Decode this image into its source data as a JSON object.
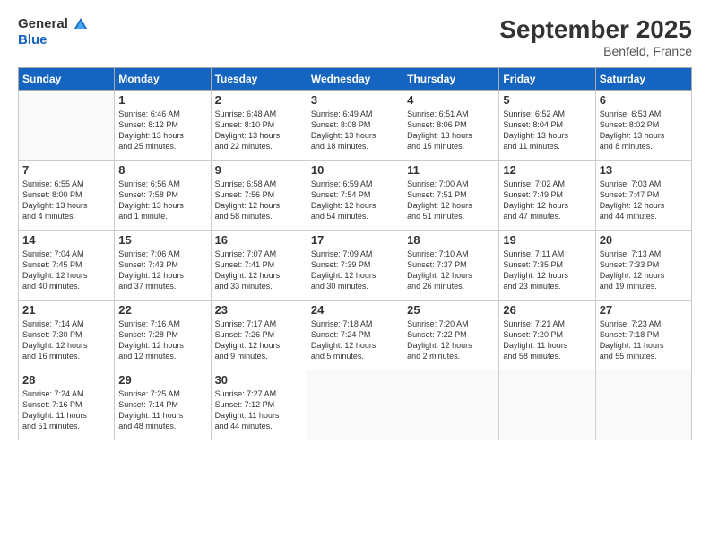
{
  "header": {
    "logo_general": "General",
    "logo_blue": "Blue",
    "month_title": "September 2025",
    "location": "Benfeld, France"
  },
  "columns": [
    "Sunday",
    "Monday",
    "Tuesday",
    "Wednesday",
    "Thursday",
    "Friday",
    "Saturday"
  ],
  "weeks": [
    {
      "days": [
        {
          "number": "",
          "lines": []
        },
        {
          "number": "1",
          "lines": [
            "Sunrise: 6:46 AM",
            "Sunset: 8:12 PM",
            "Daylight: 13 hours",
            "and 25 minutes."
          ]
        },
        {
          "number": "2",
          "lines": [
            "Sunrise: 6:48 AM",
            "Sunset: 8:10 PM",
            "Daylight: 13 hours",
            "and 22 minutes."
          ]
        },
        {
          "number": "3",
          "lines": [
            "Sunrise: 6:49 AM",
            "Sunset: 8:08 PM",
            "Daylight: 13 hours",
            "and 18 minutes."
          ]
        },
        {
          "number": "4",
          "lines": [
            "Sunrise: 6:51 AM",
            "Sunset: 8:06 PM",
            "Daylight: 13 hours",
            "and 15 minutes."
          ]
        },
        {
          "number": "5",
          "lines": [
            "Sunrise: 6:52 AM",
            "Sunset: 8:04 PM",
            "Daylight: 13 hours",
            "and 11 minutes."
          ]
        },
        {
          "number": "6",
          "lines": [
            "Sunrise: 6:53 AM",
            "Sunset: 8:02 PM",
            "Daylight: 13 hours",
            "and 8 minutes."
          ]
        }
      ]
    },
    {
      "days": [
        {
          "number": "7",
          "lines": [
            "Sunrise: 6:55 AM",
            "Sunset: 8:00 PM",
            "Daylight: 13 hours",
            "and 4 minutes."
          ]
        },
        {
          "number": "8",
          "lines": [
            "Sunrise: 6:56 AM",
            "Sunset: 7:58 PM",
            "Daylight: 13 hours",
            "and 1 minute."
          ]
        },
        {
          "number": "9",
          "lines": [
            "Sunrise: 6:58 AM",
            "Sunset: 7:56 PM",
            "Daylight: 12 hours",
            "and 58 minutes."
          ]
        },
        {
          "number": "10",
          "lines": [
            "Sunrise: 6:59 AM",
            "Sunset: 7:54 PM",
            "Daylight: 12 hours",
            "and 54 minutes."
          ]
        },
        {
          "number": "11",
          "lines": [
            "Sunrise: 7:00 AM",
            "Sunset: 7:51 PM",
            "Daylight: 12 hours",
            "and 51 minutes."
          ]
        },
        {
          "number": "12",
          "lines": [
            "Sunrise: 7:02 AM",
            "Sunset: 7:49 PM",
            "Daylight: 12 hours",
            "and 47 minutes."
          ]
        },
        {
          "number": "13",
          "lines": [
            "Sunrise: 7:03 AM",
            "Sunset: 7:47 PM",
            "Daylight: 12 hours",
            "and 44 minutes."
          ]
        }
      ]
    },
    {
      "days": [
        {
          "number": "14",
          "lines": [
            "Sunrise: 7:04 AM",
            "Sunset: 7:45 PM",
            "Daylight: 12 hours",
            "and 40 minutes."
          ]
        },
        {
          "number": "15",
          "lines": [
            "Sunrise: 7:06 AM",
            "Sunset: 7:43 PM",
            "Daylight: 12 hours",
            "and 37 minutes."
          ]
        },
        {
          "number": "16",
          "lines": [
            "Sunrise: 7:07 AM",
            "Sunset: 7:41 PM",
            "Daylight: 12 hours",
            "and 33 minutes."
          ]
        },
        {
          "number": "17",
          "lines": [
            "Sunrise: 7:09 AM",
            "Sunset: 7:39 PM",
            "Daylight: 12 hours",
            "and 30 minutes."
          ]
        },
        {
          "number": "18",
          "lines": [
            "Sunrise: 7:10 AM",
            "Sunset: 7:37 PM",
            "Daylight: 12 hours",
            "and 26 minutes."
          ]
        },
        {
          "number": "19",
          "lines": [
            "Sunrise: 7:11 AM",
            "Sunset: 7:35 PM",
            "Daylight: 12 hours",
            "and 23 minutes."
          ]
        },
        {
          "number": "20",
          "lines": [
            "Sunrise: 7:13 AM",
            "Sunset: 7:33 PM",
            "Daylight: 12 hours",
            "and 19 minutes."
          ]
        }
      ]
    },
    {
      "days": [
        {
          "number": "21",
          "lines": [
            "Sunrise: 7:14 AM",
            "Sunset: 7:30 PM",
            "Daylight: 12 hours",
            "and 16 minutes."
          ]
        },
        {
          "number": "22",
          "lines": [
            "Sunrise: 7:16 AM",
            "Sunset: 7:28 PM",
            "Daylight: 12 hours",
            "and 12 minutes."
          ]
        },
        {
          "number": "23",
          "lines": [
            "Sunrise: 7:17 AM",
            "Sunset: 7:26 PM",
            "Daylight: 12 hours",
            "and 9 minutes."
          ]
        },
        {
          "number": "24",
          "lines": [
            "Sunrise: 7:18 AM",
            "Sunset: 7:24 PM",
            "Daylight: 12 hours",
            "and 5 minutes."
          ]
        },
        {
          "number": "25",
          "lines": [
            "Sunrise: 7:20 AM",
            "Sunset: 7:22 PM",
            "Daylight: 12 hours",
            "and 2 minutes."
          ]
        },
        {
          "number": "26",
          "lines": [
            "Sunrise: 7:21 AM",
            "Sunset: 7:20 PM",
            "Daylight: 11 hours",
            "and 58 minutes."
          ]
        },
        {
          "number": "27",
          "lines": [
            "Sunrise: 7:23 AM",
            "Sunset: 7:18 PM",
            "Daylight: 11 hours",
            "and 55 minutes."
          ]
        }
      ]
    },
    {
      "days": [
        {
          "number": "28",
          "lines": [
            "Sunrise: 7:24 AM",
            "Sunset: 7:16 PM",
            "Daylight: 11 hours",
            "and 51 minutes."
          ]
        },
        {
          "number": "29",
          "lines": [
            "Sunrise: 7:25 AM",
            "Sunset: 7:14 PM",
            "Daylight: 11 hours",
            "and 48 minutes."
          ]
        },
        {
          "number": "30",
          "lines": [
            "Sunrise: 7:27 AM",
            "Sunset: 7:12 PM",
            "Daylight: 11 hours",
            "and 44 minutes."
          ]
        },
        {
          "number": "",
          "lines": []
        },
        {
          "number": "",
          "lines": []
        },
        {
          "number": "",
          "lines": []
        },
        {
          "number": "",
          "lines": []
        }
      ]
    }
  ]
}
